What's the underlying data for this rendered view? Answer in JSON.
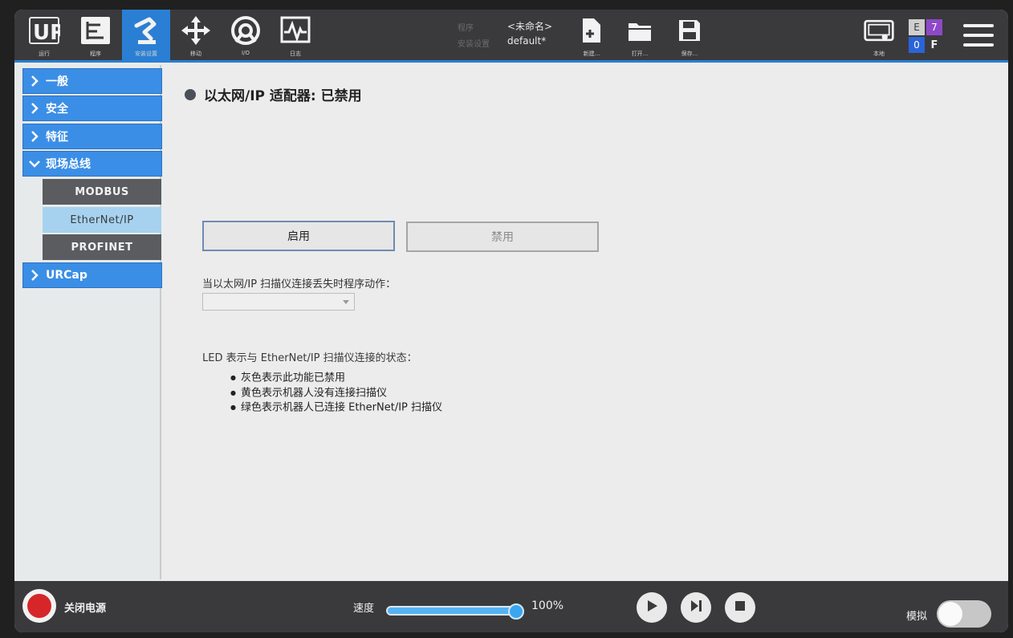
{
  "header": {
    "tabs": [
      {
        "label": "运行",
        "icon": "ur-logo-icon"
      },
      {
        "label": "程序",
        "icon": "program-icon"
      },
      {
        "label": "安装设置",
        "icon": "installation-icon",
        "active": true
      },
      {
        "label": "移动",
        "icon": "move-icon"
      },
      {
        "label": "I/O",
        "icon": "io-icon"
      },
      {
        "label": "日志",
        "icon": "log-icon"
      }
    ],
    "file": {
      "program_key": "程序",
      "program_value": "<未命名>",
      "install_key": "安装设置",
      "install_value": "default*"
    },
    "file_actions": [
      {
        "label": "新建...",
        "icon": "new-file-icon"
      },
      {
        "label": "打开...",
        "icon": "open-folder-icon"
      },
      {
        "label": "保存...",
        "icon": "save-icon"
      }
    ],
    "local_label": "本地",
    "indicator": {
      "e": "E",
      "num": "7",
      "zero": "0",
      "f": "F"
    },
    "menu_icon": "hamburger-menu-icon"
  },
  "sidebar": {
    "items": [
      {
        "label": "一般"
      },
      {
        "label": "安全"
      },
      {
        "label": "特征"
      },
      {
        "label": "现场总线"
      }
    ],
    "subitems": [
      {
        "label": "MODBUS"
      },
      {
        "label": "EtherNet/IP"
      },
      {
        "label": "PROFINET"
      }
    ],
    "urcap": {
      "label": "URCap"
    }
  },
  "main": {
    "title": "以太网/IP 适配器: 已禁用",
    "enable_label": "启用",
    "disable_label": "禁用",
    "loss_action_label": "当以太网/IP 扫描仪连接丢失时程序动作：",
    "loss_action_value": "",
    "led_heading": "LED 表示与 EtherNet/IP 扫描仪连接的状态：",
    "bullets": [
      "灰色表示此功能已禁用",
      "黄色表示机器人没有连接扫描仪",
      "绿色表示机器人已连接 EtherNet/IP 扫描仪"
    ]
  },
  "footer": {
    "power_label": "关闭电源",
    "speed_label": "速度",
    "speed_value": "100%",
    "speed_fraction": 1.0,
    "sim_label": "模拟",
    "sim_on": false
  },
  "colors": {
    "accent": "#2a7fd4",
    "nav_bg": "#3b8ee6",
    "sub_bg": "#5a5c60",
    "selected": "#a6d2f0",
    "power_red": "#d6262a"
  }
}
